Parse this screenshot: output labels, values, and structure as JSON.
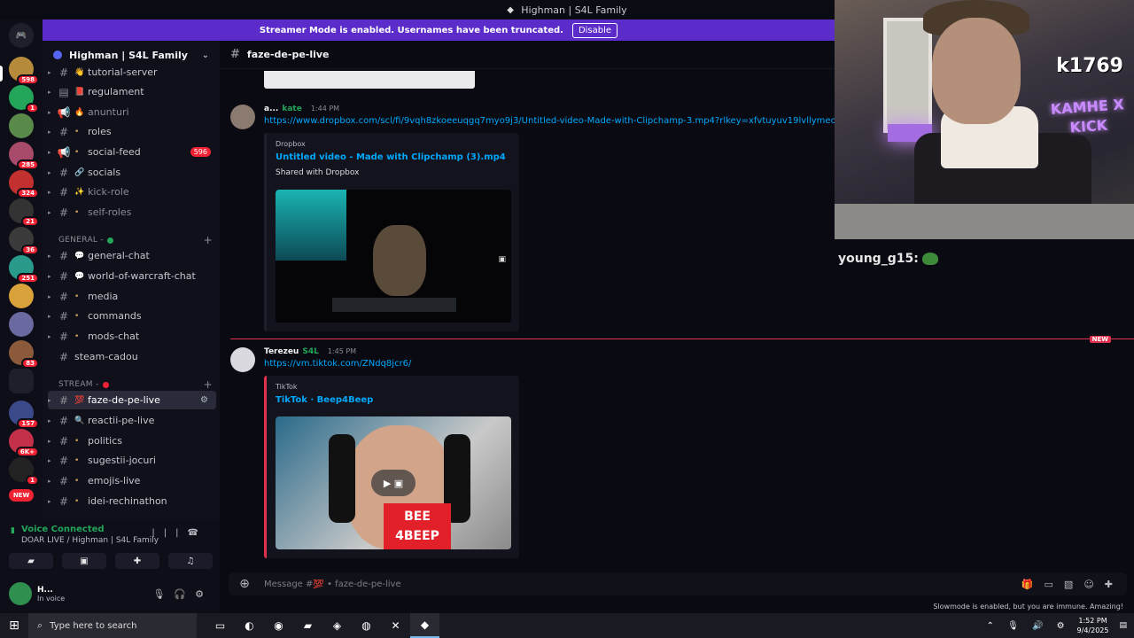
{
  "window": {
    "title": "Highman | S4L Family"
  },
  "banner": {
    "text": "Streamer Mode is enabled. Usernames have been truncated.",
    "button": "Disable"
  },
  "rail": {
    "badges": [
      "598",
      "1",
      "285",
      "324",
      "21",
      "36",
      "251",
      "83",
      "157",
      "6K+",
      "1",
      "NEW"
    ]
  },
  "server": {
    "name": "Highman | S4L Family"
  },
  "channels_top": [
    {
      "name": "tutorial-server",
      "emoji": "👋"
    },
    {
      "name": "regulament",
      "emoji": "📕"
    },
    {
      "name": "anunturi",
      "emoji": "🔥"
    },
    {
      "name": "roles",
      "emoji": "•"
    },
    {
      "name": "social-feed",
      "emoji": "•",
      "count": "596"
    },
    {
      "name": "socials",
      "emoji": "🔗"
    },
    {
      "name": "kick-role",
      "emoji": "✨"
    },
    {
      "name": "self-roles",
      "emoji": "•"
    }
  ],
  "categories": {
    "general": "GENERAL -",
    "stream": "STREAM -"
  },
  "channels_general": [
    {
      "name": "general-chat",
      "emoji": "💬"
    },
    {
      "name": "world-of-warcraft-chat",
      "emoji": "💬"
    },
    {
      "name": "media",
      "emoji": "•"
    },
    {
      "name": "commands",
      "emoji": "•"
    },
    {
      "name": "mods-chat",
      "emoji": "•"
    },
    {
      "name": "steam-cadou",
      "emoji": ""
    }
  ],
  "channels_stream": [
    {
      "name": "faze-de-pe-live",
      "emoji": "💯"
    },
    {
      "name": "reactii-pe-live",
      "emoji": "🔍"
    },
    {
      "name": "politics",
      "emoji": "•"
    },
    {
      "name": "sugestii-jocuri",
      "emoji": "•"
    },
    {
      "name": "emojis-live",
      "emoji": "•"
    },
    {
      "name": "idei-rechinathon",
      "emoji": "•"
    }
  ],
  "voice": {
    "status": "Voice Connected",
    "channel": "DOAR LIVE / Highman | S4L Family",
    "user_name": "H...",
    "user_status": "In voice"
  },
  "chat": {
    "channel": "faze-de-pe-live",
    "messages": [
      {
        "author": "a...",
        "tag": "kate",
        "time": "1:44 PM",
        "link": "https://www.dropbox.com/scl/fi/9vqh8zkoeeuqgq7myo9j3/Untitled-video-Made-with-Clipchamp-3.mp4?rlkey=xfvtuyuv19lvllymeow8h92gt&s",
        "provider": "Dropbox",
        "title": "Untitled video - Made with Clipchamp (3).mp4",
        "description": "Shared with Dropbox"
      },
      {
        "author": "Terezeu",
        "tag": "S4L",
        "time": "1:45 PM",
        "link": "https://vm.tiktok.com/ZNdq8jcr6/",
        "provider": "TikTok",
        "title": "TikTok · Beep4Beep",
        "thumb_text": "BEE 4BEEP"
      }
    ],
    "new_marker": "NEW",
    "composer_placeholder": "Message #💯 • faze-de-pe-live",
    "slowmode": "Slowmode is enabled, but you are immune. Amazing!"
  },
  "stream": {
    "watermark": "k1769",
    "sign": "KAMHE X KICK",
    "chat_user": "young_g15:"
  },
  "taskbar": {
    "search_placeholder": "Type here to search",
    "time": "1:52 PM",
    "date": "9/4/2025"
  }
}
